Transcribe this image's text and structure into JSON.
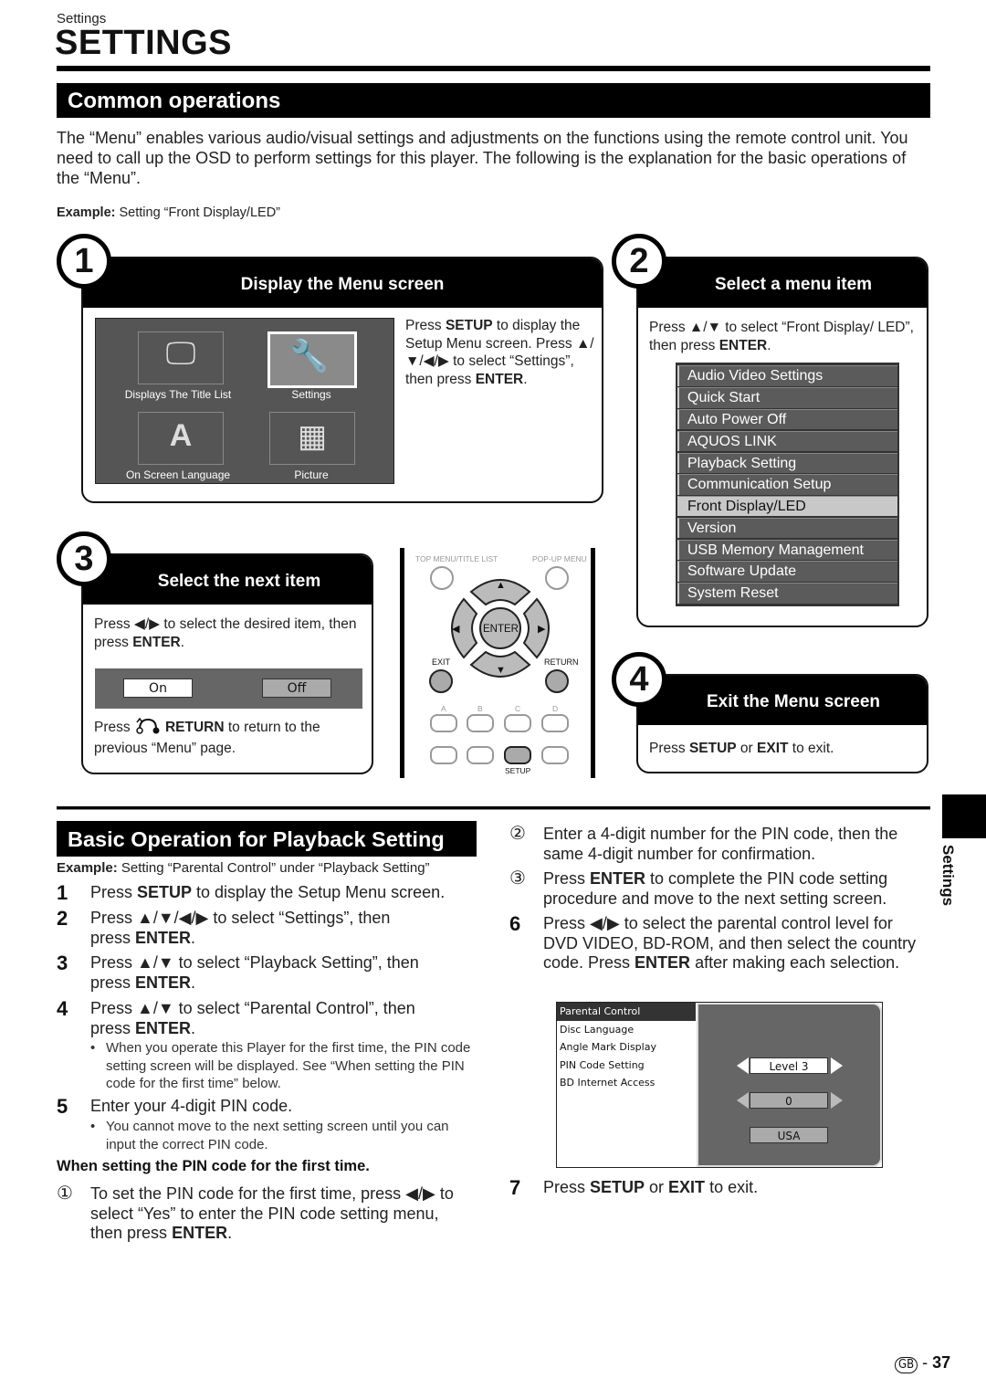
{
  "header": {
    "breadcrumb": "Settings",
    "title": "SETTINGS"
  },
  "common": {
    "section_title": "Common operations",
    "intro": "The “Menu” enables various audio/visual settings and adjustments on the functions using the remote control unit. You need to call up the OSD to perform settings for this player. The following is the explanation for the basic operations of the “Menu”.",
    "example_label": "Example:",
    "example_text": " Setting “Front Display/LED”"
  },
  "steps": {
    "s1": {
      "number": "1",
      "title": "Display the Menu screen",
      "text_a": "Press ",
      "text_b": "SETUP",
      "text_c": " to display the Setup Menu screen. Press ▲/▼/◀/▶ to select “Settings”, then press ",
      "text_d": "ENTER",
      "text_e": ".",
      "menu_tiles": [
        {
          "label": "Displays The Title List",
          "icon": "tv-icon",
          "glyph": "🖵",
          "selected": false
        },
        {
          "label": "Settings",
          "icon": "wrench-icon",
          "glyph": "🔧",
          "selected": true
        },
        {
          "label": "On Screen Language",
          "icon": "language-icon",
          "glyph": "A",
          "selected": false
        },
        {
          "label": "Picture",
          "icon": "picture-album-icon",
          "glyph": "▦",
          "selected": false
        }
      ]
    },
    "s2": {
      "number": "2",
      "title": "Select a menu item",
      "text_a": "Press ▲/▼ to select “Front Display/ LED”, then press ",
      "text_b": "ENTER",
      "text_c": ".",
      "menu_items": [
        {
          "label": "Audio Video Settings",
          "selected": false
        },
        {
          "label": "Quick Start",
          "selected": false
        },
        {
          "label": "Auto Power Off",
          "selected": false
        },
        {
          "label": "AQUOS LINK",
          "selected": false
        },
        {
          "label": "Playback Setting",
          "selected": false
        },
        {
          "label": "Communication Setup",
          "selected": false
        },
        {
          "label": "Front Display/LED",
          "selected": true
        },
        {
          "label": "Version",
          "selected": false
        },
        {
          "label": "USB Memory Management",
          "selected": false
        },
        {
          "label": "Software Update",
          "selected": false
        },
        {
          "label": "System Reset",
          "selected": false
        }
      ]
    },
    "s3": {
      "number": "3",
      "title": "Select the next item",
      "text_a": "Press ◀/▶ to select the desired item, then press ",
      "text_b": "ENTER",
      "text_c": ".",
      "option_on": "On",
      "option_off": "Off",
      "return_a": "Press ",
      "return_b": "RETURN",
      "return_c": " to return to the previous “Menu” page."
    },
    "s4": {
      "number": "4",
      "title": "Exit the Menu screen",
      "text_a": "Press ",
      "text_b": "SETUP",
      "text_c": " or ",
      "text_d": "EXIT",
      "text_e": " to exit."
    }
  },
  "remote": {
    "top_menu": "TOP MENU/TITLE LIST",
    "popup_menu": "POP-UP MENU",
    "enter": "ENTER",
    "up": "▲",
    "down": "▼",
    "left": "◀",
    "right": "▶",
    "exit": "EXIT",
    "return": "RETURN",
    "a": "A",
    "b": "B",
    "c": "C",
    "d": "D",
    "setup": "SETUP"
  },
  "playback": {
    "section_title": "Basic Operation for Playback Setting",
    "example_label": "Example:",
    "example_text": " Setting “Parental Control” under “Playback Setting”",
    "step1": {
      "n": "1",
      "a": "Press ",
      "b": "SETUP",
      "c": " to display the Setup Menu screen."
    },
    "step2": {
      "n": "2",
      "a": "Press ▲/▼/◀/▶ to select “Settings”, then",
      "b": "press ",
      "c": "ENTER",
      "d": "."
    },
    "step3": {
      "n": "3",
      "a": "Press ▲/▼ to select “Playback Setting”, then",
      "b": "press ",
      "c": "ENTER",
      "d": "."
    },
    "step4": {
      "n": "4",
      "a": "Press ▲/▼ to select “Parental Control”, then",
      "b": "press ",
      "c": "ENTER",
      "d": "."
    },
    "step4_note": "When you operate this Player for the first time, the PIN code setting screen will be displayed. See “When setting the PIN code for the first time” below.",
    "step5": {
      "n": "5",
      "a": "Enter your 4-digit PIN code."
    },
    "step5_note": "You cannot move to the next setting screen until you can input the correct PIN code.",
    "bullet": "•",
    "first_time_heading": "When setting the PIN code for the first time.",
    "sub1": {
      "n": "①",
      "a": "To set the PIN code for the first time, press ◀/▶ to select “Yes” to enter the PIN code setting menu, then press ",
      "b": "ENTER",
      "c": "."
    },
    "sub2": {
      "n": "②",
      "a": "Enter a 4-digit number for the PIN code, then the same 4-digit number for confirmation."
    },
    "sub3": {
      "n": "③",
      "a": "Press ",
      "b": "ENTER",
      "c": " to complete the PIN code setting procedure and move to the next setting screen."
    },
    "step6": {
      "n": "6",
      "a": "Press ◀/▶ to select the parental control level for DVD VIDEO, BD-ROM, and then select the country code. Press ",
      "b": "ENTER",
      "c": " after making each selection."
    },
    "step7": {
      "n": "7",
      "a": "Press ",
      "b": "SETUP",
      "c": " or ",
      "d": "EXIT",
      "e": " to exit."
    }
  },
  "parental_screen": {
    "items": [
      {
        "label": "Parental Control",
        "selected": true
      },
      {
        "label": "Disc Language",
        "selected": false
      },
      {
        "label": "Angle Mark Display",
        "selected": false
      },
      {
        "label": "PIN Code Setting",
        "selected": false
      },
      {
        "label": "BD Internet Access",
        "selected": false
      }
    ],
    "level_value": "Level 3",
    "second_value": "0",
    "country_value": "USA"
  },
  "side_tab": {
    "label": "Settings"
  },
  "footer": {
    "region": "GB",
    "separator": " - ",
    "page": "37"
  }
}
